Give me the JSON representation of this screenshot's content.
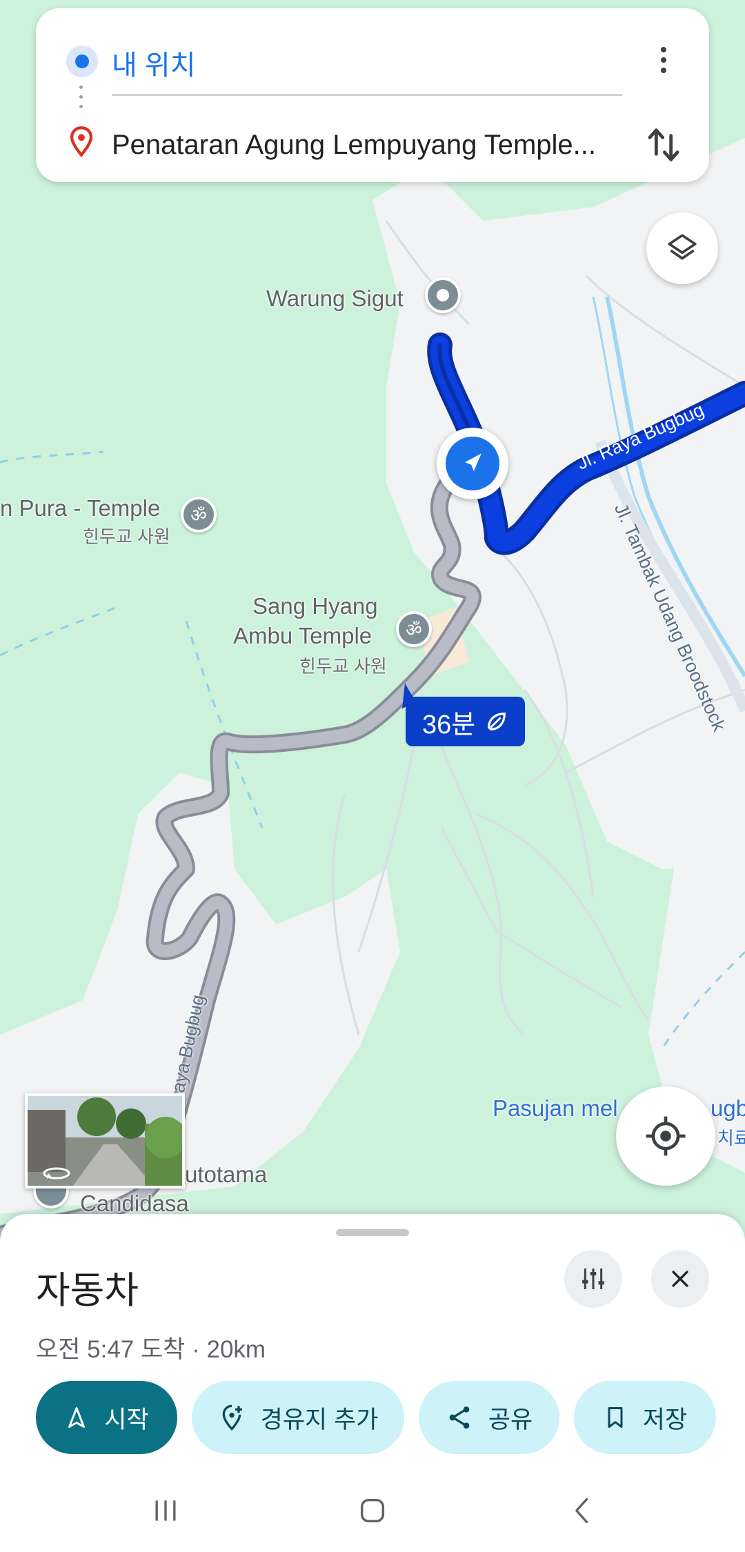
{
  "search": {
    "origin": "내 위치",
    "destination": "Penataran Agung Lempuyang Temple..."
  },
  "map": {
    "pois": [
      {
        "name": "Warung Sigut"
      },
      {
        "name": "n Pura - Temple",
        "sub": "힌두교 사원"
      },
      {
        "name_line1": "Sang Hyang",
        "name_line2": "Ambu Temple",
        "sub": "힌두교 사원"
      },
      {
        "name": "Pasujan mel",
        "name_tail": "ugb",
        "sub_tail": "치료"
      },
      {
        "name_line1": "utotama",
        "name_line2": "Candidasa"
      }
    ],
    "roads": {
      "raya_bugbug": "Jl. Raya Bugbug",
      "tambak": "Jl. Tambak Udang Broodstock",
      "raya_bugbug_lower": "aya Bugbug"
    },
    "eta_label": "36분"
  },
  "sheet": {
    "mode": "자동차",
    "arrival": "오전 5:47 도착 · 20km",
    "start": "시작",
    "add_stop": "경유지 추가",
    "share": "공유",
    "save": "저장"
  },
  "colors": {
    "route_blue": "#0b3fc9",
    "route_gray": "#b7b9c3",
    "primary_button": "#0b7285",
    "secondary_button": "#cdf2f8",
    "map_green": "#ccf2dc"
  },
  "icons": [
    "origin-dot-icon",
    "destination-pin-icon",
    "more-vert-icon",
    "swap-icon",
    "layers-icon",
    "navigation-arrow-icon",
    "leaf-icon",
    "my-location-icon",
    "tune-icon",
    "close-icon",
    "navigation-icon",
    "add-location-icon",
    "share-icon",
    "bookmark-icon",
    "recents-icon",
    "home-icon",
    "back-icon"
  ]
}
